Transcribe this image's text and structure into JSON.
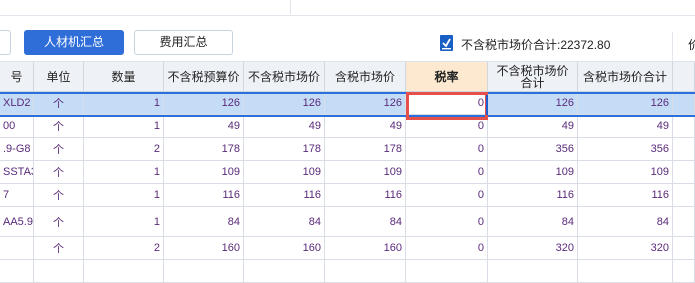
{
  "toolbar": {
    "partial_left_button": "",
    "buttons": [
      {
        "label": "人材机汇总",
        "active": true
      },
      {
        "label": "费用汇总",
        "active": false
      }
    ],
    "total_label": "不含税市场价合计:22372.80",
    "total_checked": true,
    "overflow_label": "价"
  },
  "colors": {
    "active_button": "#2f6ed9",
    "selected_row": "#c5dcf7",
    "edit_border": "#e5514a",
    "selected_header": "#fde9cf",
    "cell_text": "#5a2a7a"
  },
  "table": {
    "headers": [
      "号",
      "单位",
      "数量",
      "不含税预算价",
      "不含税市场价",
      "含税市场价",
      "税率",
      "不含税市场价合计",
      "含税市场价合计"
    ],
    "rows": [
      [
        "XLD2",
        "个",
        "1",
        "126",
        "126",
        "126",
        "0",
        "126",
        "126"
      ],
      [
        "00",
        "个",
        "1",
        "49",
        "49",
        "49",
        "0",
        "49",
        "49"
      ],
      ".9-G8|个|2|178|178|178|0|356|356",
      [
        "SSTA3",
        "个",
        "1",
        "109",
        "109",
        "109",
        "0",
        "109",
        "109"
      ],
      [
        "7",
        "个",
        "1",
        "116",
        "116",
        "116",
        "0",
        "116",
        "116"
      ],
      [
        "AA5.9-",
        "个",
        "1",
        "84",
        "84",
        "84",
        "0",
        "84",
        "84"
      ],
      [
        "",
        "个",
        "2",
        "160",
        "160",
        "160",
        "0",
        "320",
        "320"
      ],
      [
        "",
        "",
        "",
        "",
        "",
        "",
        "",
        "",
        ""
      ]
    ],
    "selected_row_index": 0,
    "editing_column": "税率"
  }
}
